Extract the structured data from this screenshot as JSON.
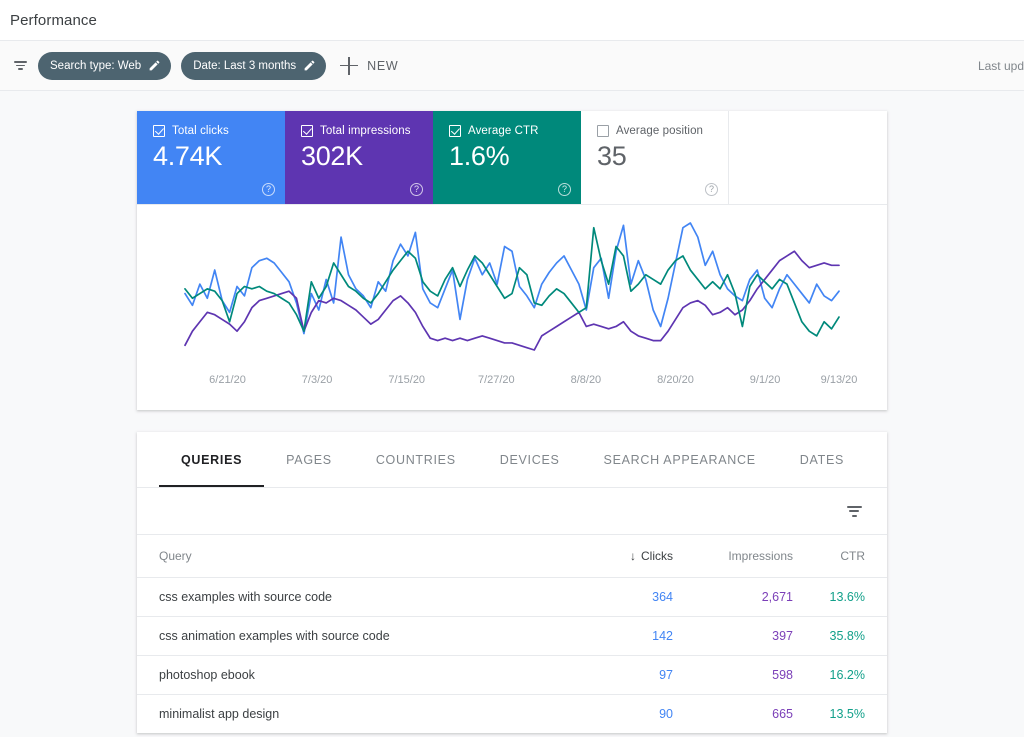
{
  "header": {
    "title": "Performance"
  },
  "filterbar": {
    "filter_icon": "filter-icon",
    "chips": [
      {
        "label": "Search type: Web",
        "edit_icon": "pencil-icon"
      },
      {
        "label": "Date: Last 3 months",
        "edit_icon": "pencil-icon"
      }
    ],
    "new_button": {
      "label": "NEW",
      "icon": "plus-icon"
    },
    "last_updated": "Last upd"
  },
  "metrics": [
    {
      "label": "Total clicks",
      "value": "4.74K",
      "checked": true,
      "color": "#4285f4",
      "help": "?"
    },
    {
      "label": "Total impressions",
      "value": "302K",
      "checked": true,
      "color": "#5e35b1",
      "help": "?"
    },
    {
      "label": "Average CTR",
      "value": "1.6%",
      "checked": true,
      "color": "#00897b",
      "help": "?"
    },
    {
      "label": "Average position",
      "value": "35",
      "checked": false,
      "color": "#ffffff",
      "help": "?"
    }
  ],
  "chart_data": {
    "type": "line",
    "title": "",
    "xlabel": "",
    "ylabel": "",
    "grid": false,
    "legend": "none",
    "x_tick_labels": [
      "6/21/20",
      "7/3/20",
      "7/15/20",
      "7/27/20",
      "8/8/20",
      "8/20/20",
      "9/1/20",
      "9/13/20"
    ],
    "x_tick_positions_pct": [
      6.5,
      20.2,
      33.9,
      47.6,
      61.3,
      75.0,
      88.7,
      100.0
    ],
    "series": [
      {
        "name": "Total clicks",
        "color": "#4285f4",
        "values": [
          42,
          37,
          46,
          40,
          52,
          39,
          34,
          45,
          41,
          53,
          56,
          57,
          55,
          51,
          47,
          38,
          25,
          42,
          35,
          48,
          38,
          66,
          50,
          44,
          41,
          36,
          47,
          43,
          56,
          63,
          58,
          68,
          44,
          38,
          36,
          44,
          52,
          31,
          48,
          57,
          50,
          55,
          46,
          62,
          60,
          45,
          41,
          36,
          46,
          51,
          55,
          58,
          52,
          46,
          35,
          53,
          57,
          40,
          60,
          71,
          46,
          56,
          48,
          35,
          28,
          40,
          55,
          70,
          72,
          66,
          54,
          60,
          50,
          44,
          41,
          39,
          48,
          52,
          40,
          36,
          44,
          50,
          46,
          42,
          38,
          46,
          41,
          39,
          43
        ]
      },
      {
        "name": "Total impressions",
        "color": "#5e35b1",
        "values": [
          20,
          26,
          30,
          34,
          33,
          31,
          29,
          26,
          30,
          36,
          39,
          40,
          41,
          42,
          43,
          40,
          26,
          34,
          39,
          38,
          40,
          39,
          37,
          35,
          32,
          29,
          31,
          35,
          39,
          41,
          38,
          34,
          28,
          23,
          22,
          23,
          22,
          23,
          22,
          23,
          24,
          23,
          22,
          21,
          21,
          20,
          19,
          18,
          24,
          26,
          28,
          30,
          32,
          34,
          28,
          29,
          28,
          27,
          28,
          30,
          26,
          24,
          23,
          22,
          22,
          26,
          31,
          36,
          38,
          39,
          37,
          33,
          34,
          36,
          33,
          35,
          39,
          44,
          48,
          52,
          56,
          58,
          60,
          56,
          53,
          54,
          55,
          54,
          54
        ]
      },
      {
        "name": "Average CTR",
        "color": "#00897b",
        "values": [
          44,
          40,
          42,
          44,
          43,
          39,
          30,
          42,
          45,
          44,
          45,
          43,
          42,
          40,
          38,
          33,
          26,
          47,
          40,
          45,
          55,
          50,
          45,
          43,
          40,
          38,
          42,
          47,
          52,
          56,
          60,
          57,
          47,
          43,
          41,
          48,
          53,
          45,
          52,
          58,
          55,
          50,
          45,
          40,
          42,
          53,
          50,
          38,
          37,
          41,
          44,
          42,
          38,
          34,
          36,
          70,
          56,
          46,
          62,
          58,
          43,
          46,
          50,
          48,
          46,
          52,
          56,
          58,
          52,
          48,
          44,
          47,
          44,
          50,
          42,
          28,
          45,
          50,
          47,
          44,
          48,
          46,
          38,
          30,
          26,
          24,
          30,
          27,
          32
        ]
      }
    ]
  },
  "table": {
    "tabs": [
      {
        "label": "QUERIES",
        "active": true
      },
      {
        "label": "PAGES",
        "active": false
      },
      {
        "label": "COUNTRIES",
        "active": false
      },
      {
        "label": "DEVICES",
        "active": false
      },
      {
        "label": "SEARCH APPEARANCE",
        "active": false
      },
      {
        "label": "DATES",
        "active": false
      }
    ],
    "toolbar": {
      "filter_icon": "filter-icon"
    },
    "columns": {
      "query": "Query",
      "clicks": "Clicks",
      "impressions": "Impressions",
      "ctr": "CTR",
      "sort_arrow": "↓"
    },
    "rows": [
      {
        "query": "css examples with source code",
        "clicks": "364",
        "impressions": "2,671",
        "ctr": "13.6%"
      },
      {
        "query": "css animation examples with source code",
        "clicks": "142",
        "impressions": "397",
        "ctr": "35.8%"
      },
      {
        "query": "photoshop ebook",
        "clicks": "97",
        "impressions": "598",
        "ctr": "16.2%"
      },
      {
        "query": "minimalist app design",
        "clicks": "90",
        "impressions": "665",
        "ctr": "13.5%"
      }
    ]
  }
}
